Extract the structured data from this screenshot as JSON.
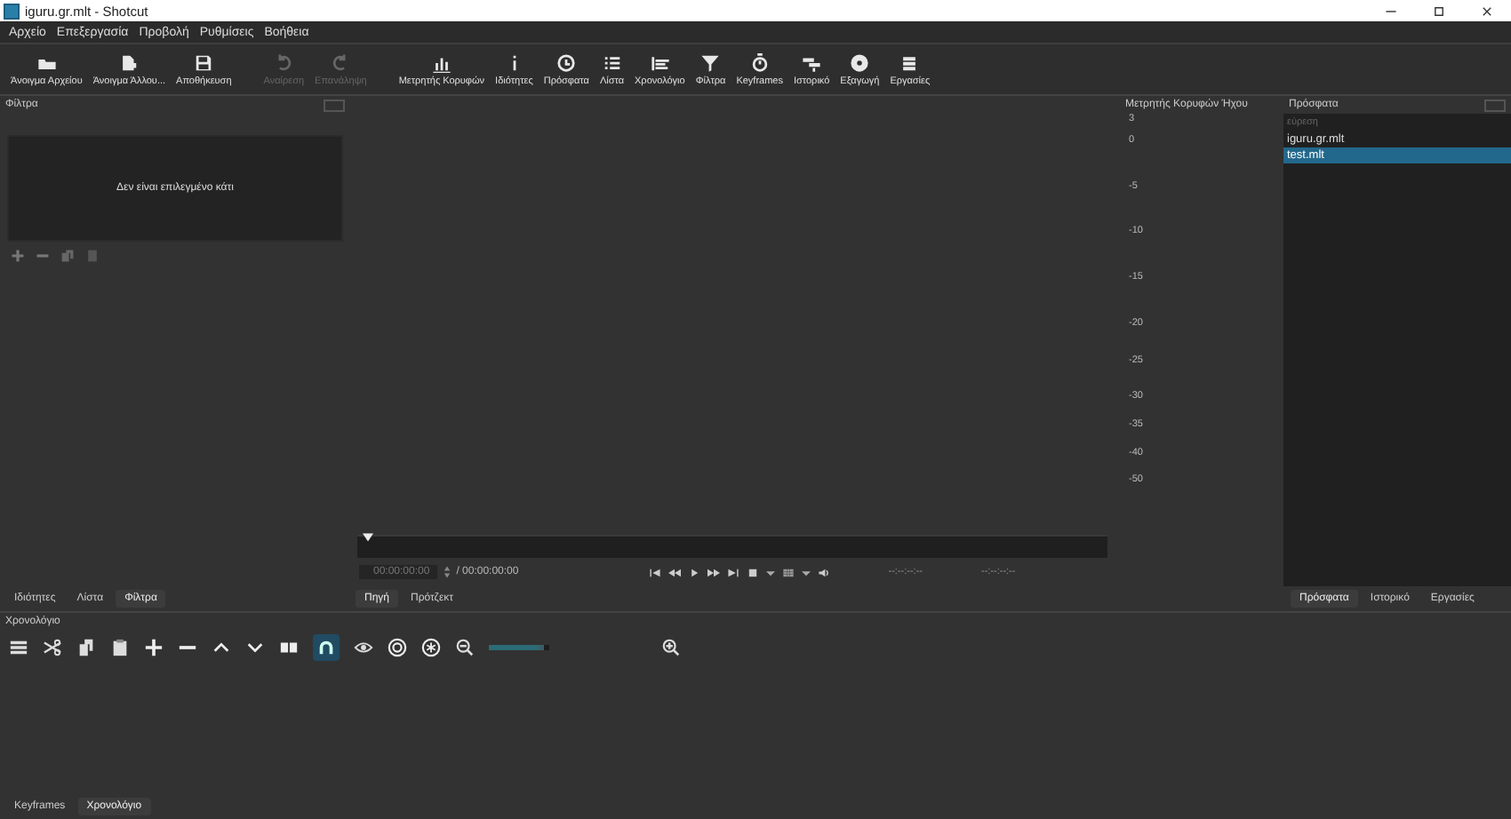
{
  "window": {
    "title": "iguru.gr.mlt - Shotcut"
  },
  "menu": [
    "Αρχείο",
    "Επεξεργασία",
    "Προβολή",
    "Ρυθμίσεις",
    "Βοήθεια"
  ],
  "toolbar": [
    {
      "label": "Άνοιγμα Αρχείου",
      "disabled": false
    },
    {
      "label": "Άνοιγμα Άλλου...",
      "disabled": false
    },
    {
      "label": "Αποθήκευση",
      "disabled": false
    },
    {
      "label": "Αναίρεση",
      "disabled": true
    },
    {
      "label": "Επανάληψη",
      "disabled": true
    },
    {
      "label": "Μετρητής Κορυφών",
      "disabled": false
    },
    {
      "label": "Ιδιότητες",
      "disabled": false
    },
    {
      "label": "Πρόσφατα",
      "disabled": false
    },
    {
      "label": "Λίστα",
      "disabled": false
    },
    {
      "label": "Χρονολόγιο",
      "disabled": false
    },
    {
      "label": "Φίλτρα",
      "disabled": false
    },
    {
      "label": "Keyframes",
      "disabled": false
    },
    {
      "label": "Ιστορικό",
      "disabled": false
    },
    {
      "label": "Εξαγωγή",
      "disabled": false
    },
    {
      "label": "Εργασίες",
      "disabled": false
    }
  ],
  "filters": {
    "title": "Φίλτρα",
    "empty_message": "Δεν είναι επιλεγμένο κάτι"
  },
  "left_tabs": [
    {
      "label": "Ιδιότητες",
      "selected": false
    },
    {
      "label": "Λίστα",
      "selected": false
    },
    {
      "label": "Φίλτρα",
      "selected": true
    }
  ],
  "player": {
    "timecode": "00:00:00:00",
    "duration": "/ 00:00:00:00",
    "in_point": "--:--:--:--",
    "out_point": "--:--:--:--",
    "tabs": [
      {
        "label": "Πηγή",
        "selected": true
      },
      {
        "label": "Πρότζεκτ",
        "selected": false
      }
    ]
  },
  "meter": {
    "title": "Μετρητής Κορυφών Ήχου",
    "scale": [
      "3",
      "0",
      "-5",
      "-10",
      "-15",
      "-20",
      "-25",
      "-30",
      "-35",
      "-40",
      "-50"
    ]
  },
  "recent": {
    "title": "Πρόσφατα",
    "search_placeholder": "εύρεση",
    "items": [
      {
        "name": "iguru.gr.mlt",
        "selected": false
      },
      {
        "name": "test.mlt",
        "selected": true
      }
    ],
    "tabs": [
      {
        "label": "Πρόσφατα",
        "selected": true
      },
      {
        "label": "Ιστορικό",
        "selected": false
      },
      {
        "label": "Εργασίες",
        "selected": false
      }
    ]
  },
  "timeline": {
    "title": "Χρονολόγιο",
    "snap_on": true,
    "zoom": {
      "level": 0.9
    },
    "tabs": [
      {
        "label": "Keyframes",
        "selected": false
      },
      {
        "label": "Χρονολόγιο",
        "selected": true
      }
    ]
  }
}
